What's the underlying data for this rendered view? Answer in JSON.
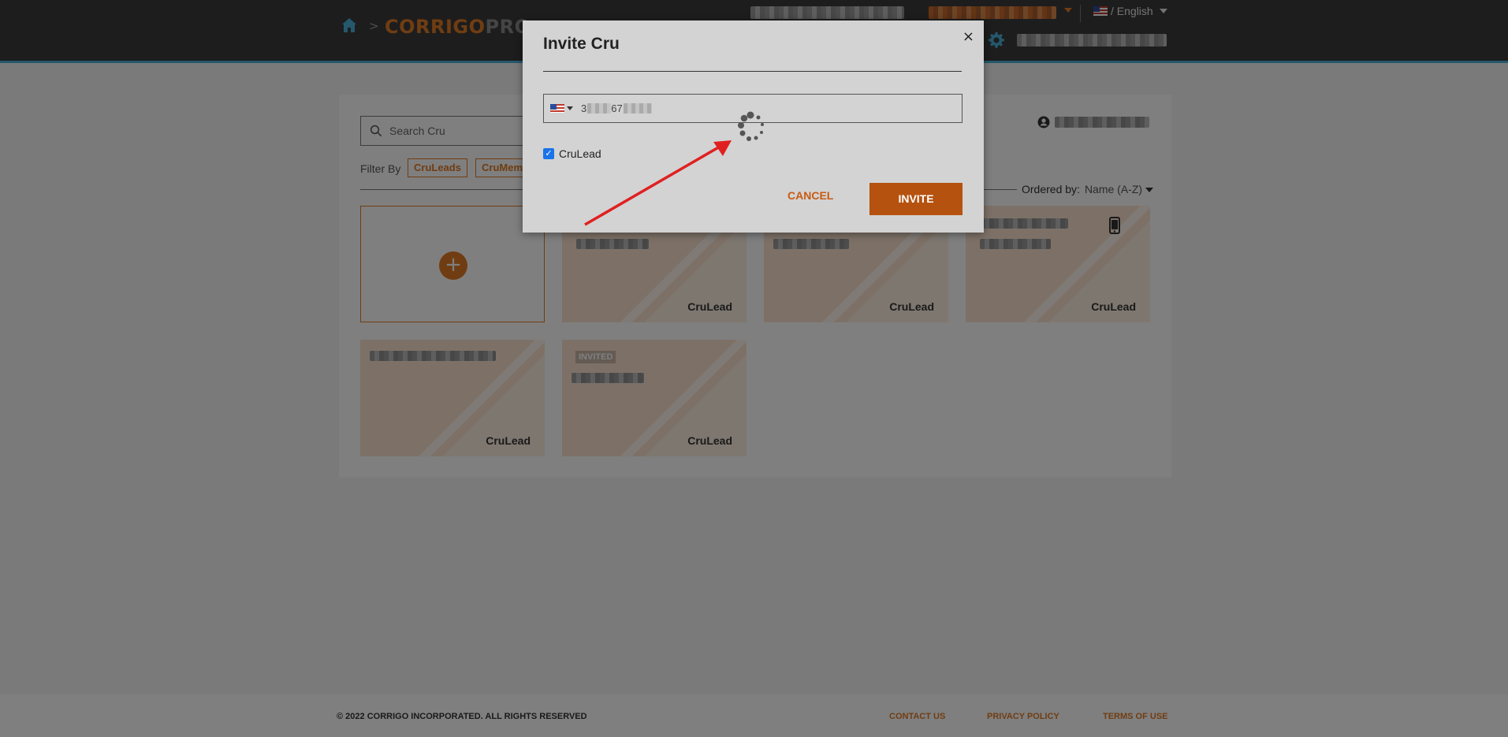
{
  "header": {
    "logo_part1": "CORRIGO",
    "logo_part2": "PRO",
    "breadcrumb_separator": ">",
    "language": "/ English"
  },
  "panel": {
    "search_placeholder": "Search Cru",
    "filter_label": "Filter By",
    "filter_chips": [
      "CruLeads",
      "CruMem"
    ],
    "ordered_label": "Ordered by:",
    "ordered_value": "Name (A-Z)",
    "cards": [
      {
        "role": "CruLead"
      },
      {
        "role": "CruLead"
      },
      {
        "role": "CruLead"
      },
      {
        "role": "CruLead"
      },
      {
        "role": "CruLead",
        "badge": "INVITED"
      }
    ]
  },
  "modal": {
    "title": "Invite Cru",
    "close_glyph": "×",
    "phone_visible": "3",
    "phone_visible2": "67",
    "checkbox_label": "CruLead",
    "checkbox_checked": true,
    "cancel_label": "CANCEL",
    "invite_label": "INVITE"
  },
  "footer": {
    "copyright": "© 2022 CORRIGO INCORPORATED. ALL RIGHTS RESERVED",
    "contact": "CONTACT US",
    "privacy": "PRIVACY POLICY",
    "terms": "TERMS OF USE"
  },
  "colors": {
    "accent": "#e07a24",
    "header_bg": "#3b3b3b",
    "header_border": "#4ab0d9",
    "invite_button": "#b5520f",
    "annotation_arrow": "#e02020"
  }
}
